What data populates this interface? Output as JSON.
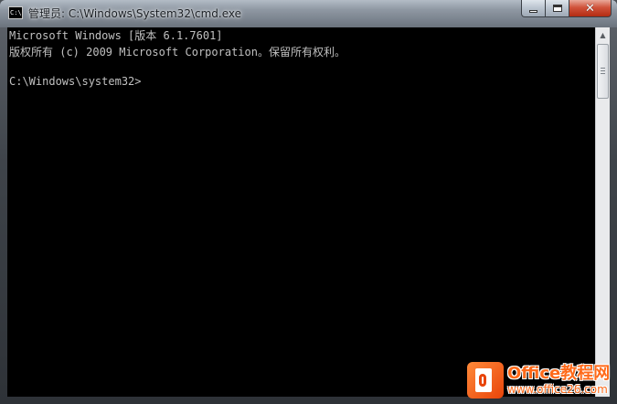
{
  "window": {
    "title": "管理员: C:\\Windows\\System32\\cmd.exe",
    "icon": "cmd-console-icon",
    "icon_glyph": "C:\\",
    "controls": {
      "minimize_icon": "minimize-icon",
      "maximize_icon": "maximize-icon",
      "close_icon": "close-icon",
      "close_glyph": "✕"
    }
  },
  "console": {
    "background_color": "#000000",
    "text_color": "#c0c0c0",
    "lines": [
      "Microsoft Windows [版本 6.1.7601]",
      "版权所有 (c) 2009 Microsoft Corporation。保留所有权利。",
      "",
      "C:\\Windows\\system32>"
    ]
  },
  "scrollbar": {
    "up_glyph": "▲",
    "down_glyph": "▼"
  },
  "watermark": {
    "title": "Office教程网",
    "url": "www.office26.com",
    "accent_color": "#ff6a1a"
  }
}
